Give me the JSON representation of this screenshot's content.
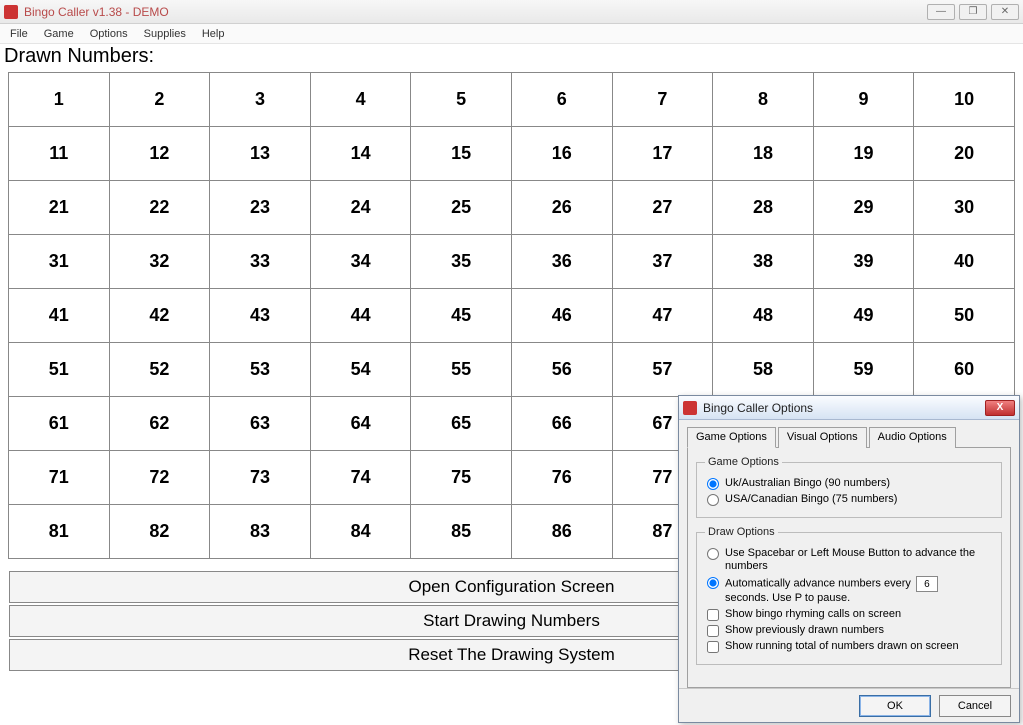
{
  "titlebar": {
    "text": "Bingo Caller v1.38 - DEMO"
  },
  "menu": {
    "items": [
      "File",
      "Game",
      "Options",
      "Supplies",
      "Help"
    ]
  },
  "drawn_label": "Drawn Numbers:",
  "grid": {
    "rows": 9,
    "cols": 10,
    "start": 1,
    "end": 90
  },
  "actions": {
    "open_config": "Open Configuration Screen",
    "start_drawing": "Start Drawing Numbers",
    "reset_drawing": "Reset The Drawing System"
  },
  "dialog": {
    "title": "Bingo Caller Options",
    "tabs": [
      "Game Options",
      "Visual Options",
      "Audio Options"
    ],
    "active_tab": 0,
    "game_options_group": "Game Options",
    "game_options": {
      "uk": {
        "label": "Uk/Australian Bingo (90 numbers)",
        "checked": true
      },
      "usa": {
        "label": "USA/Canadian Bingo (75 numbers)",
        "checked": false
      }
    },
    "draw_options_group": "Draw Options",
    "draw_options": {
      "spacebar": {
        "label": "Use Spacebar or Left Mouse Button to advance the numbers",
        "checked": false
      },
      "auto_pre": "Automatically advance numbers every",
      "auto_value": "6",
      "auto_post": "seconds. Use P to pause.",
      "auto_checked": true,
      "show_rhyming": {
        "label": "Show bingo rhyming calls on screen",
        "checked": false
      },
      "show_previous": {
        "label": "Show previously drawn numbers",
        "checked": false
      },
      "show_total": {
        "label": "Show running total of numbers drawn on screen",
        "checked": false
      }
    },
    "buttons": {
      "ok": "OK",
      "cancel": "Cancel"
    }
  }
}
